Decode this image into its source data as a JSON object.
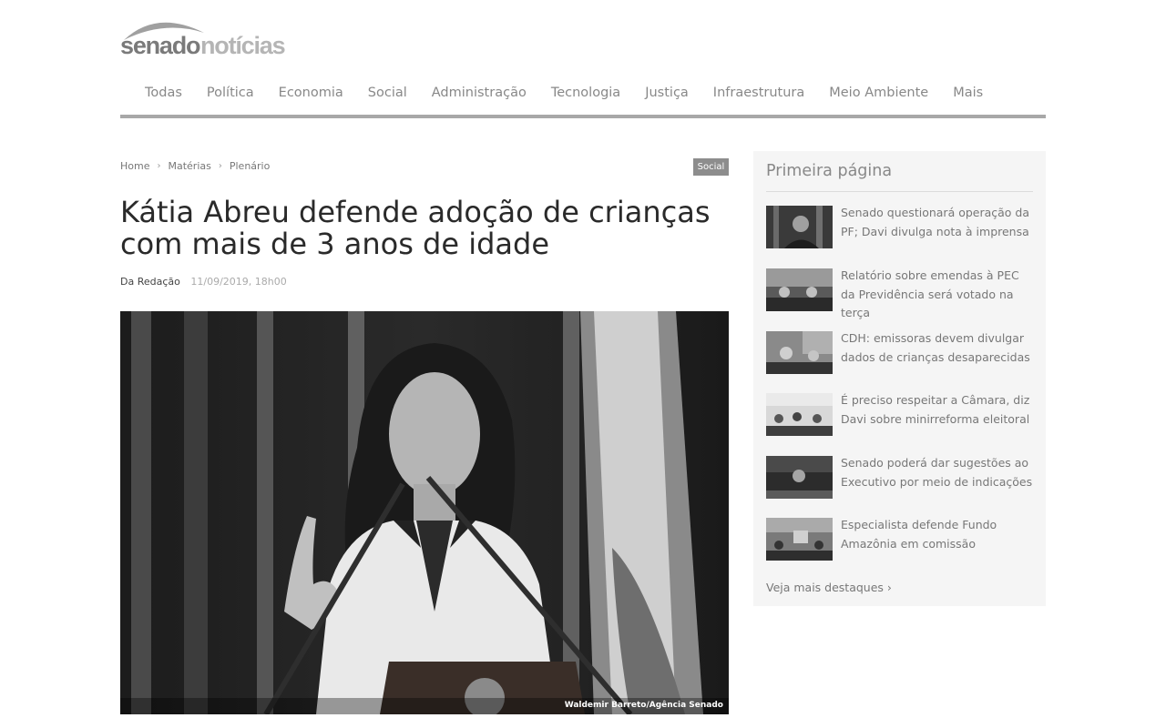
{
  "site": {
    "logo_text_1": "senado",
    "logo_text_2": "notícias"
  },
  "nav": {
    "items": [
      "Todas",
      "Política",
      "Economia",
      "Social",
      "Administração",
      "Tecnologia",
      "Justiça",
      "Infraestrutura",
      "Meio Ambiente",
      "Mais"
    ]
  },
  "breadcrumb": {
    "items": [
      "Home",
      "Matérias",
      "Plenário"
    ],
    "separator": "›"
  },
  "article": {
    "tag": "Social",
    "title": "Kátia Abreu defende adoção de crianças com mais de 3 anos de idade",
    "author": "Da Redação",
    "date": "11/09/2019, 18h00",
    "photo_credit": "Waldemir Barreto/Agência Senado"
  },
  "sidebar": {
    "title": "Primeira página",
    "items": [
      {
        "text": "Senado questionará operação da PF; Davi divulga nota à imprensa"
      },
      {
        "text": "Relatório sobre emendas à PEC da Previdência será votado na terça"
      },
      {
        "text": "CDH: emissoras devem divulgar dados de crianças desaparecidas"
      },
      {
        "text": "É preciso respeitar a Câmara, diz Davi sobre minirreforma eleitoral"
      },
      {
        "text": "Senado poderá dar sugestões ao Executivo por meio de indicações"
      },
      {
        "text": "Especialista defende Fundo Amazônia em comissão"
      }
    ],
    "more_link": "Veja mais destaques ›"
  },
  "icons": [
    "senado-logo-icon"
  ]
}
